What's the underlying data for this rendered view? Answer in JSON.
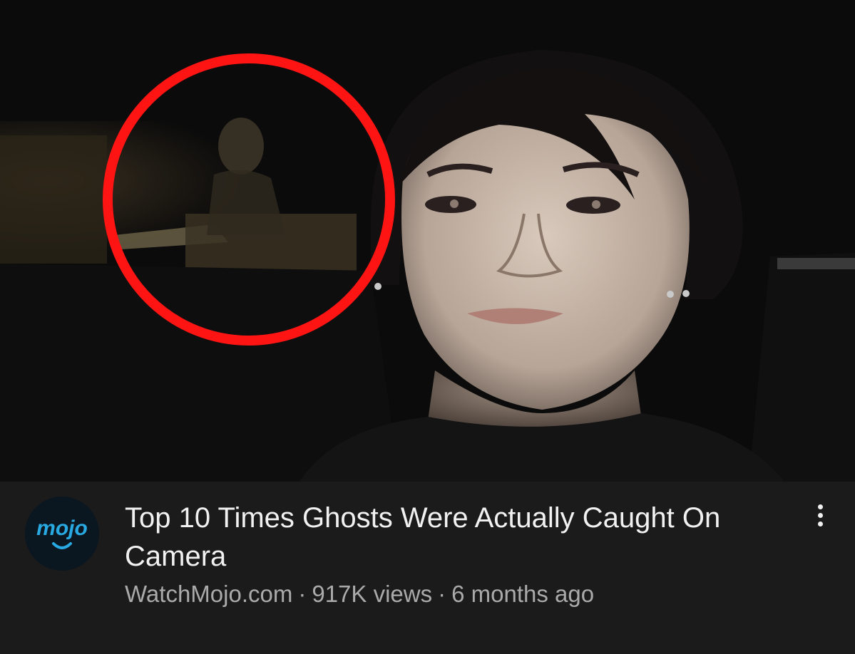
{
  "video": {
    "title": "Top 10 Times Ghosts Were Actually Caught On Camera",
    "channel": "WatchMojo.com",
    "separator": "·",
    "views": "917K views",
    "age": "6 months ago"
  },
  "channel_avatar": {
    "logo_text": "mojo",
    "accent_color": "#29a9e1"
  },
  "thumbnail": {
    "highlight_color": "#ff1414"
  },
  "icons": {
    "more": "more-vertical-icon"
  }
}
